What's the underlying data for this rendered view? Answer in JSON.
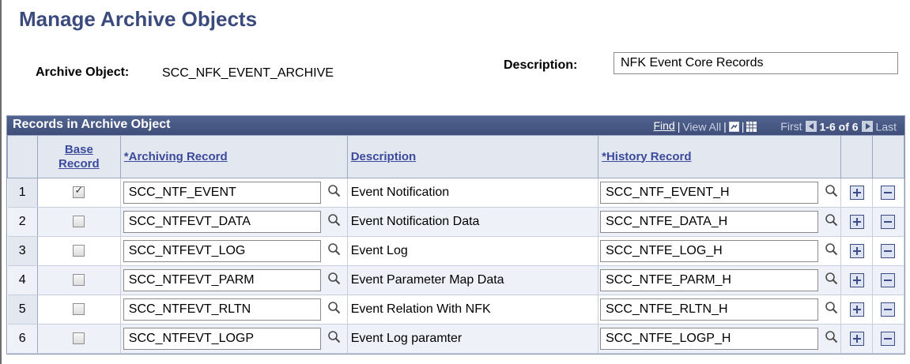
{
  "page_title": "Manage Archive Objects",
  "archive_object": {
    "label": "Archive Object:",
    "value": "SCC_NFK_EVENT_ARCHIVE"
  },
  "description": {
    "label": "Description:",
    "value": "NFK Event Core Records"
  },
  "grid": {
    "title": "Records in Archive Object",
    "nav": {
      "find": "Find",
      "sep": "|",
      "view_all": "View All",
      "first": "First",
      "range": "1-6 of 6",
      "last": "Last"
    },
    "headers": {
      "base_record_line1": "Base",
      "base_record_line2": "Record",
      "archiving_record": "*Archiving Record",
      "description": "Description",
      "history_record": "*History Record"
    },
    "rows": [
      {
        "num": "1",
        "base": true,
        "archiving": "SCC_NTF_EVENT",
        "description": "Event Notification",
        "history": "SCC_NTF_EVENT_H"
      },
      {
        "num": "2",
        "base": false,
        "archiving": "SCC_NTFEVT_DATA",
        "description": "Event Notification Data",
        "history": "SCC_NTFE_DATA_H"
      },
      {
        "num": "3",
        "base": false,
        "archiving": "SCC_NTFEVT_LOG",
        "description": "Event Log",
        "history": "SCC_NTFE_LOG_H"
      },
      {
        "num": "4",
        "base": false,
        "archiving": "SCC_NTFEVT_PARM",
        "description": "Event Parameter Map Data",
        "history": "SCC_NTFE_PARM_H"
      },
      {
        "num": "5",
        "base": false,
        "archiving": "SCC_NTFEVT_RLTN",
        "description": "Event Relation With NFK",
        "history": "SCC_NTFE_RLTN_H"
      },
      {
        "num": "6",
        "base": false,
        "archiving": "SCC_NTFEVT_LOGP",
        "description": "Event Log paramter",
        "history": "SCC_NTFE_LOGP_H"
      }
    ]
  },
  "colors": {
    "title": "#3b4a7c",
    "grid_header": "#3f4f7a",
    "link": "#3b4a9c"
  },
  "icons": {
    "lookup": "magnifier-icon",
    "add_row": "plus-icon",
    "delete_row": "minus-icon",
    "zoom": "zoom-icon",
    "download": "grid-icon"
  }
}
